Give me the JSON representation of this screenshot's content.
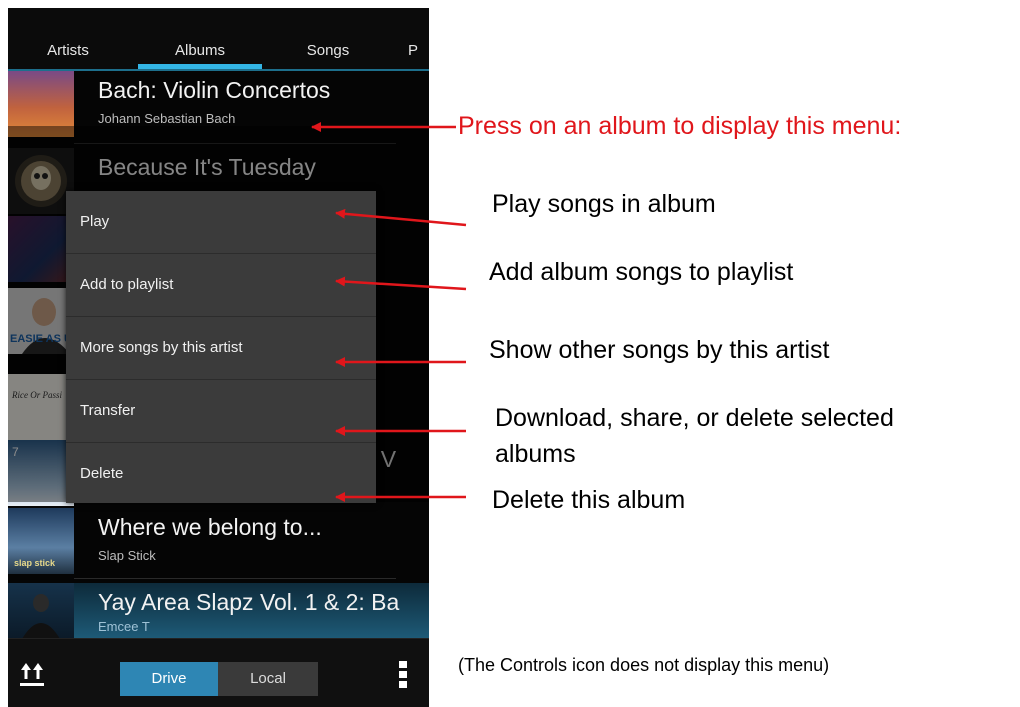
{
  "tabs": [
    {
      "label": "Artists"
    },
    {
      "label": "Albums"
    },
    {
      "label": "Songs"
    },
    {
      "label": "P"
    }
  ],
  "albums": [
    {
      "title": "Bach: Violin Concertos",
      "artist": "Johann Sebastian Bach"
    },
    {
      "title": "Because It's Tuesday",
      "artist": ""
    },
    {
      "title": "Where we belong to...",
      "artist": "Slap Stick"
    },
    {
      "title": "Yay Area Slapz Vol. 1 & 2: Ba",
      "artist": "Emcee T"
    }
  ],
  "album_art_text": {
    "easier": "EASIE AS U",
    "ricebook": "Rice Or Passi",
    "number": "7",
    "slapstick": "slap stick"
  },
  "menu": {
    "items": [
      {
        "label": "Play"
      },
      {
        "label": "Add to playlist"
      },
      {
        "label": "More songs by this artist"
      },
      {
        "label": "Transfer"
      },
      {
        "label": "Delete"
      }
    ]
  },
  "bottom_bar": {
    "drive_label": "Drive",
    "local_label": "Local",
    "sort_icon": "sort-arrows-icon",
    "overflow_icon": "overflow-menu-icon"
  },
  "annotations": {
    "press_note": "Press on an album to display this menu:",
    "play_note": "Play songs in album",
    "add_note": "Add album songs to playlist",
    "more_note": "Show other songs by this artist",
    "transfer_note_line1": "Download, share, or delete selected",
    "transfer_note_line2": "albums",
    "delete_note": "Delete this album",
    "controls_note": "(The Controls icon does not display this menu)"
  },
  "colors": {
    "accent": "#33b5e5",
    "annotation_red": "#e0161b",
    "menu_bg": "#3b3b3b"
  }
}
